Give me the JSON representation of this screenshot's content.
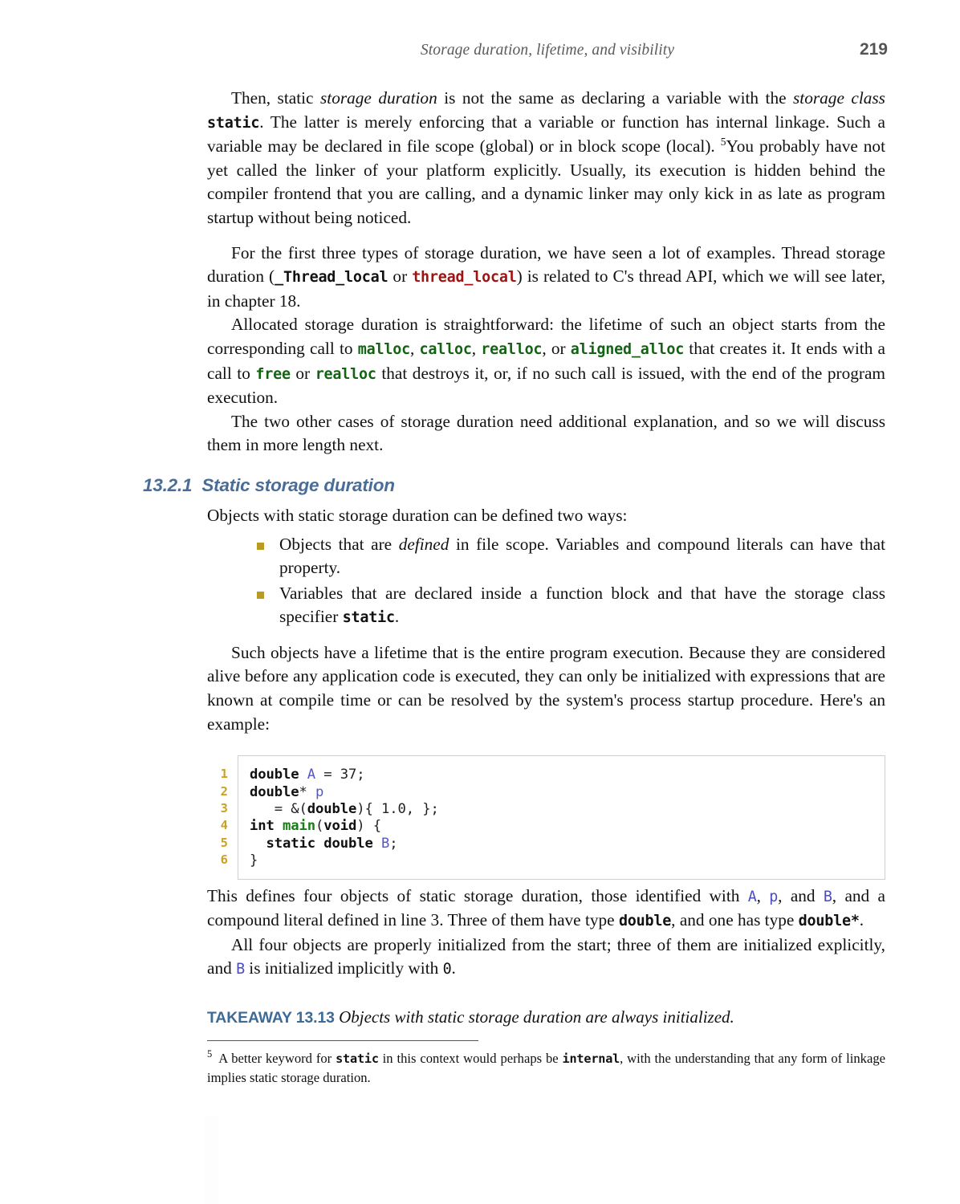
{
  "header": {
    "title": "Storage duration, lifetime, and visibility",
    "page_number": "219"
  },
  "paragraphs": {
    "p1": {
      "a": "Then, static ",
      "b_italic": "storage duration",
      "c": " is not the same as declaring a variable with the ",
      "d_italic": "storage class",
      "e_mono": "static",
      "f": ". The latter is merely enforcing that a variable or function has internal linkage. Such a variable may be declared in file scope (global) or in block scope (local). ",
      "g_sup": "5",
      "h": "You probably have not yet called the linker of your platform explicitly. Usually, its execution is hidden behind the compiler frontend that you are calling, and a dynamic linker may only kick in as late as program startup without being noticed."
    },
    "p2": {
      "a": "For the first three types of storage duration, we have seen a lot of examples. Thread storage duration (",
      "b_mono_black": "_Thread_local",
      "c": " or ",
      "d_mono_red": "thread_local",
      "e": ") is related to C's thread API, which we will see later, in chapter 18."
    },
    "p3": {
      "a": "Allocated storage duration is straightforward: the lifetime of such an object starts from the corresponding call to ",
      "b_mono_green": "malloc",
      "c": ", ",
      "d_mono_green": "calloc",
      "e": ", ",
      "f_mono_green": "realloc",
      "g": ", or ",
      "h_mono_green": "aligned_alloc",
      "i": " that creates it. It ends with a call to ",
      "j_mono_green": "free",
      "k": " or ",
      "l_mono_green": "realloc",
      "m": " that destroys it, or, if no such call is issued, with the end of the program execution."
    },
    "p4": "The two other cases of storage duration need additional explanation, and so we will discuss them in more length next.",
    "p5": "Objects with static storage duration can be defined two ways:",
    "p6": "Such objects have a lifetime that is the entire program execution. Because they are considered alive before any application code is executed, they can only be initialized with expressions that are known at compile time or can be resolved by the system's process startup procedure. Here's an example:",
    "p7": {
      "a": "This defines four objects of static storage duration, those identified with ",
      "b_mono_blue": "A",
      "c": ", ",
      "d_mono_blue": "p",
      "e": ", and ",
      "f_mono_blue": "B",
      "g": ", and a compound literal defined in line 3. Three of them have type ",
      "h_mono_black": "double",
      "i": ", and one has type ",
      "j_mono_black": "double*",
      "k": "."
    },
    "p8": {
      "a": "All four objects are properly initialized from the start; three of them are initialized explicitly, and ",
      "b_mono_blue": "B",
      "c": " is initialized implicitly with ",
      "d_mono_black": "0",
      "e": "."
    }
  },
  "section": {
    "number": "13.2.1",
    "title": "Static storage duration"
  },
  "bullets": [
    {
      "a": "Objects that are ",
      "b_italic": "defined",
      "c": " in file scope. Variables and compound literals can have that property.",
      "d_mono": "",
      "e": ""
    },
    {
      "a": "Variables that are declared inside a function block and that have the storage class specifier ",
      "b_italic": "",
      "c": "",
      "d_mono": "static",
      "e": "."
    }
  ],
  "code_listing": {
    "line_numbers": [
      "1",
      "2",
      "3",
      "4",
      "5",
      "6"
    ],
    "lines": [
      "double A = 37;",
      "double* p",
      "   = &(double){ 1.0, };",
      "int main(void) {",
      "  static double B;",
      "}"
    ]
  },
  "takeaway": {
    "label": "TAKEAWAY 13.13",
    "text": "Objects with static storage duration are always initialized."
  },
  "footnote": {
    "number": "5",
    "a": "A better keyword for ",
    "b_mono": "static",
    "c": " in this context would perhaps be ",
    "d_mono": "internal",
    "e": ", with the understanding that any form of linkage implies static storage duration."
  },
  "colors": {
    "heading_blue": "#4a6d97",
    "takeaway_blue": "#3d6b96",
    "bullet_olive": "#b89b22",
    "linenum_gold": "#c9a227",
    "code_green": "#146314",
    "code_red": "#a11212",
    "code_identifier_blue": "#5555cc",
    "codebox_border": "#cfcfcf"
  }
}
